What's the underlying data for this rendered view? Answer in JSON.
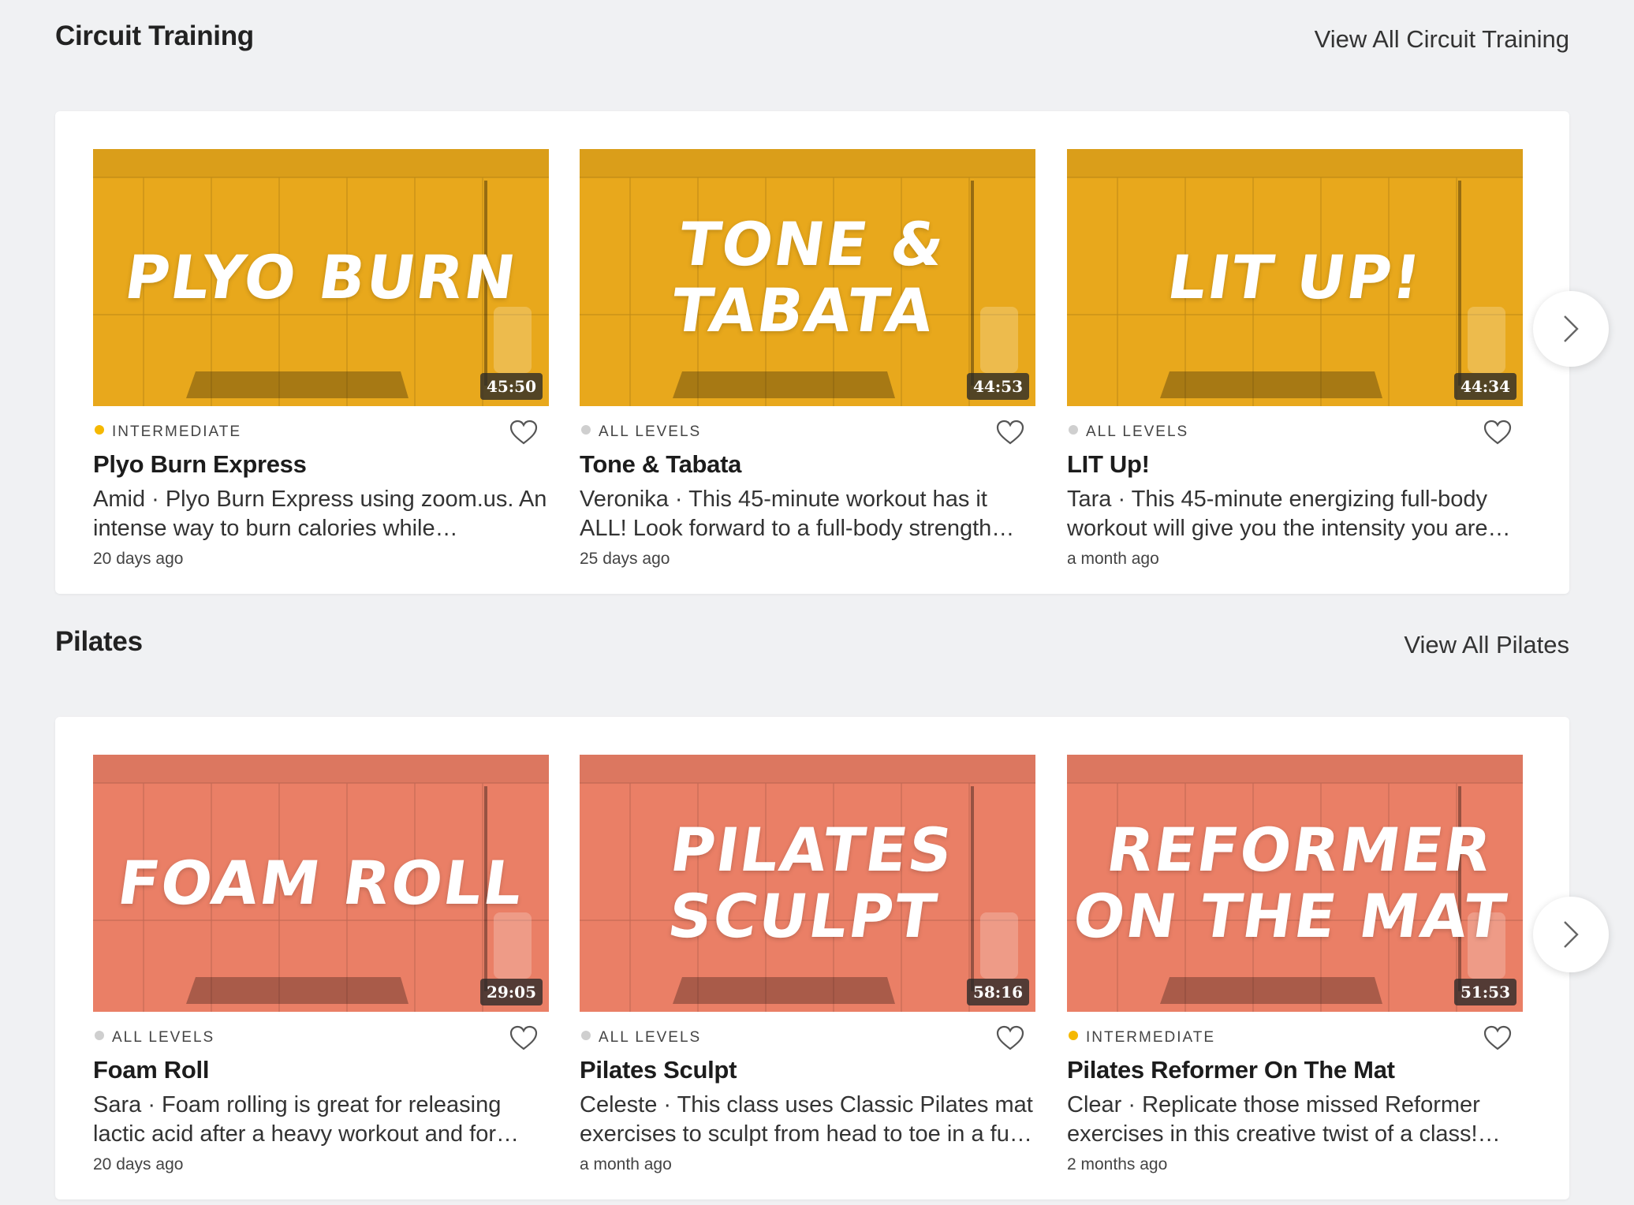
{
  "sections": [
    {
      "title": "Circuit Training",
      "view_all": "View All Circuit Training",
      "cards": [
        {
          "thumb_title": "PLYO BURN",
          "duration": "45:50",
          "level": "INTERMEDIATE",
          "level_color": "#f5b800",
          "title": "Plyo Burn Express",
          "desc": "Amid · Plyo Burn Express using zoom.us. An intense way to burn calories while…",
          "date": "20 days ago"
        },
        {
          "thumb_title": "TONE &\nTABATA",
          "duration": "44:53",
          "level": "ALL LEVELS",
          "level_color": "#cfcfcf",
          "title": "Tone & Tabata",
          "desc": "Veronika · This 45-minute workout has it ALL! Look forward to a full-body strength…",
          "date": "25 days ago"
        },
        {
          "thumb_title": "LIT UP!",
          "duration": "44:34",
          "level": "ALL LEVELS",
          "level_color": "#cfcfcf",
          "title": "LIT Up!",
          "desc": "Tara · This 45-minute energizing full-body workout will give you the intensity you are…",
          "date": "a month ago"
        }
      ]
    },
    {
      "title": "Pilates",
      "view_all": "View All Pilates",
      "cards": [
        {
          "thumb_title": "FOAM ROLL",
          "duration": "29:05",
          "level": "ALL LEVELS",
          "level_color": "#cfcfcf",
          "title": "Foam Roll",
          "desc": "Sara · Foam rolling is great for releasing lactic acid after a heavy workout and for…",
          "date": "20 days ago"
        },
        {
          "thumb_title": "PILATES\nSCULPT",
          "duration": "58:16",
          "level": "ALL LEVELS",
          "level_color": "#cfcfcf",
          "title": "Pilates Sculpt",
          "desc": "Celeste · This class uses Classic Pilates mat exercises to sculpt from head to toe in a fu…",
          "date": "a month ago"
        },
        {
          "thumb_title": "REFORMER\nON THE MAT",
          "duration": "51:53",
          "level": "INTERMEDIATE",
          "level_color": "#f5b800",
          "title": "Pilates Reformer On The Mat",
          "desc": "Clear · Replicate those missed Reformer exercises in this creative twist of a class!…",
          "date": "2 months ago"
        }
      ]
    }
  ],
  "colors": {
    "circuit_tint": "#e8a81c",
    "pilates_tint": "#ea7f66"
  },
  "icons": {
    "heart": "heart-icon",
    "next": "chevron-right-icon"
  }
}
